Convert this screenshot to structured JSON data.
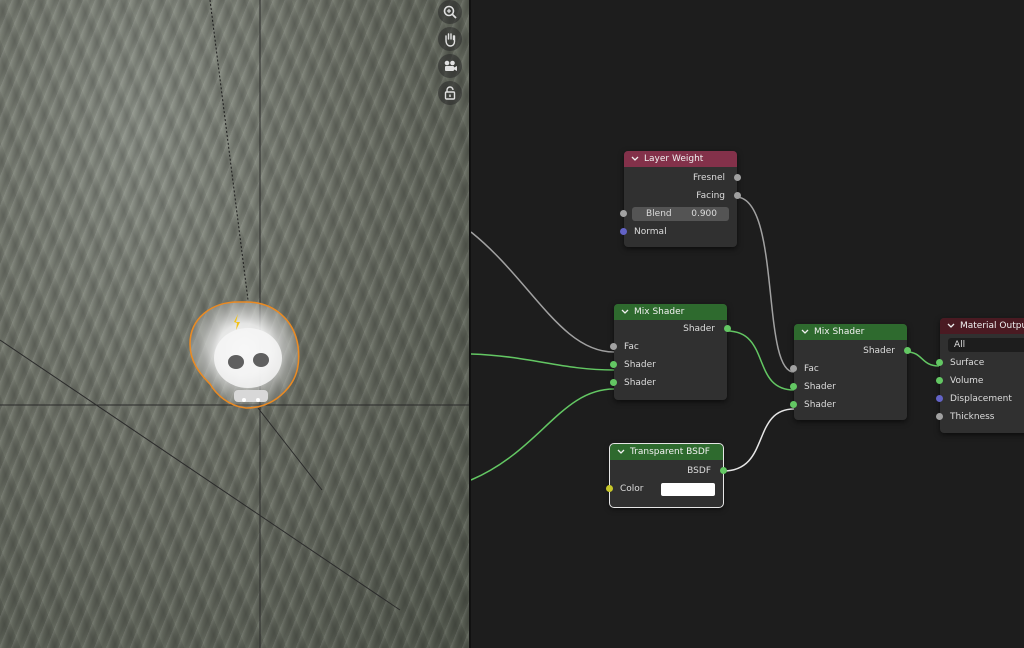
{
  "viewport": {
    "nav_icons": [
      "zoom-icon",
      "hand-pan-icon",
      "camera-icon",
      "lock-icon"
    ]
  },
  "nodes": {
    "layer_weight": {
      "title": "Layer Weight",
      "outputs": [
        "Fresnel",
        "Facing"
      ],
      "blend_label": "Blend",
      "blend_value": "0.900",
      "normal_label": "Normal"
    },
    "mix_shader_1": {
      "title": "Mix Shader",
      "output": "Shader",
      "inputs": [
        "Fac",
        "Shader",
        "Shader"
      ]
    },
    "mix_shader_2": {
      "title": "Mix Shader",
      "output": "Shader",
      "inputs": [
        "Fac",
        "Shader",
        "Shader"
      ]
    },
    "transparent_bsdf": {
      "title": "Transparent BSDF",
      "output": "BSDF",
      "color_label": "Color",
      "color_value": "#ffffff"
    },
    "material_output": {
      "title": "Material Output",
      "target": "All",
      "inputs": [
        "Surface",
        "Volume",
        "Displacement",
        "Thickness"
      ]
    }
  },
  "colors": {
    "input_header": "#83314a",
    "shader_header": "#2e6a2e",
    "output_header": "#4a1a22",
    "socket_shader": "#63c763",
    "socket_float": "#a1a1a1",
    "socket_vector": "#6363c7",
    "socket_color": "#c7c729",
    "selection_outline": "#e88a25"
  }
}
